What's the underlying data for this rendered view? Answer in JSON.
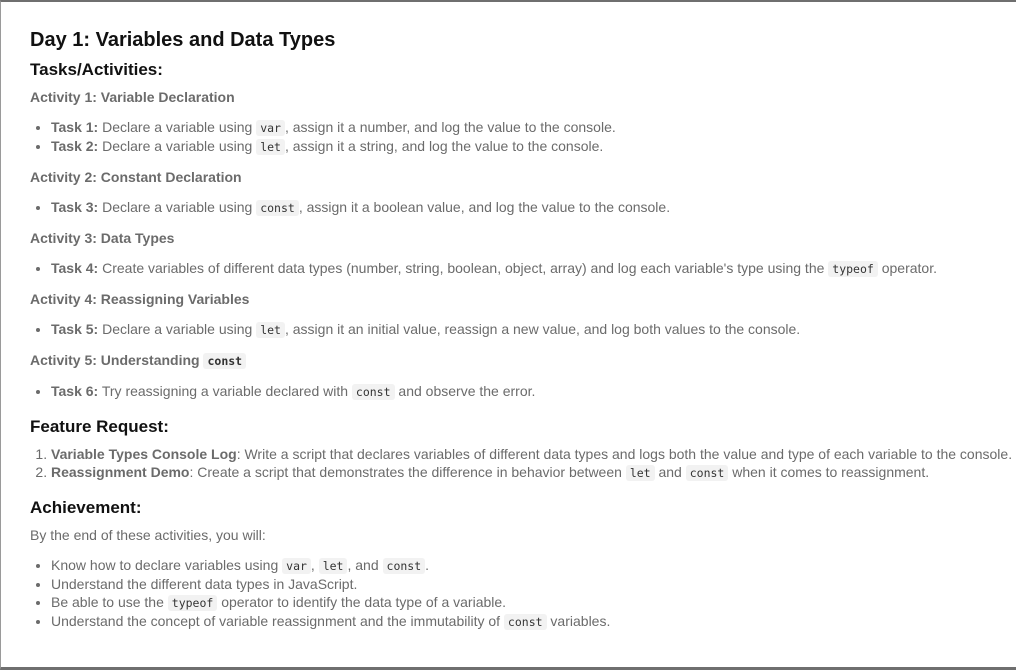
{
  "title": "Day 1: Variables and Data Types",
  "tasks_heading": "Tasks/Activities:",
  "activities": {
    "a1": {
      "title": "Activity 1: Variable Declaration",
      "t1": {
        "label": "Task 1:",
        "pre": " Declare a variable using ",
        "code": "var",
        "post": ", assign it a number, and log the value to the console."
      },
      "t2": {
        "label": "Task 2:",
        "pre": " Declare a variable using ",
        "code": "let",
        "post": ", assign it a string, and log the value to the console."
      }
    },
    "a2": {
      "title": "Activity 2: Constant Declaration",
      "t3": {
        "label": "Task 3:",
        "pre": " Declare a variable using ",
        "code": "const",
        "post": ", assign it a boolean value, and log the value to the console."
      }
    },
    "a3": {
      "title": "Activity 3: Data Types",
      "t4": {
        "label": "Task 4:",
        "pre": " Create variables of different data types (number, string, boolean, object, array) and log each variable's type using the ",
        "code": "typeof",
        "post": " operator."
      }
    },
    "a4": {
      "title": "Activity 4: Reassigning Variables",
      "t5": {
        "label": "Task 5:",
        "pre": " Declare a variable using ",
        "code": "let",
        "post": ", assign it an initial value, reassign a new value, and log both values to the console."
      }
    },
    "a5": {
      "title_pre": "Activity 5: Understanding ",
      "title_code": "const",
      "t6": {
        "label": "Task 6:",
        "pre": " Try reassigning a variable declared with ",
        "code": "const",
        "post": " and observe the error."
      }
    }
  },
  "feature": {
    "heading": "Feature Request:",
    "f1": {
      "label": "Variable Types Console Log",
      "text": ": Write a script that declares variables of different data types and logs both the value and type of each variable to the console."
    },
    "f2": {
      "label": "Reassignment Demo",
      "pre": ": Create a script that demonstrates the difference in behavior between ",
      "code1": "let",
      "mid": " and ",
      "code2": "const",
      "post": " when it comes to reassignment."
    }
  },
  "achievement": {
    "heading": "Achievement:",
    "intro": "By the end of these activities, you will:",
    "i1": {
      "pre": "Know how to declare variables using ",
      "code1": "var",
      "sep1": ", ",
      "code2": "let",
      "sep2": ", and ",
      "code3": "const",
      "post": "."
    },
    "i2": {
      "text": "Understand the different data types in JavaScript."
    },
    "i3": {
      "pre": "Be able to use the ",
      "code": "typeof",
      "post": " operator to identify the data type of a variable."
    },
    "i4": {
      "pre": "Understand the concept of variable reassignment and the immutability of ",
      "code": "const",
      "post": " variables."
    }
  }
}
